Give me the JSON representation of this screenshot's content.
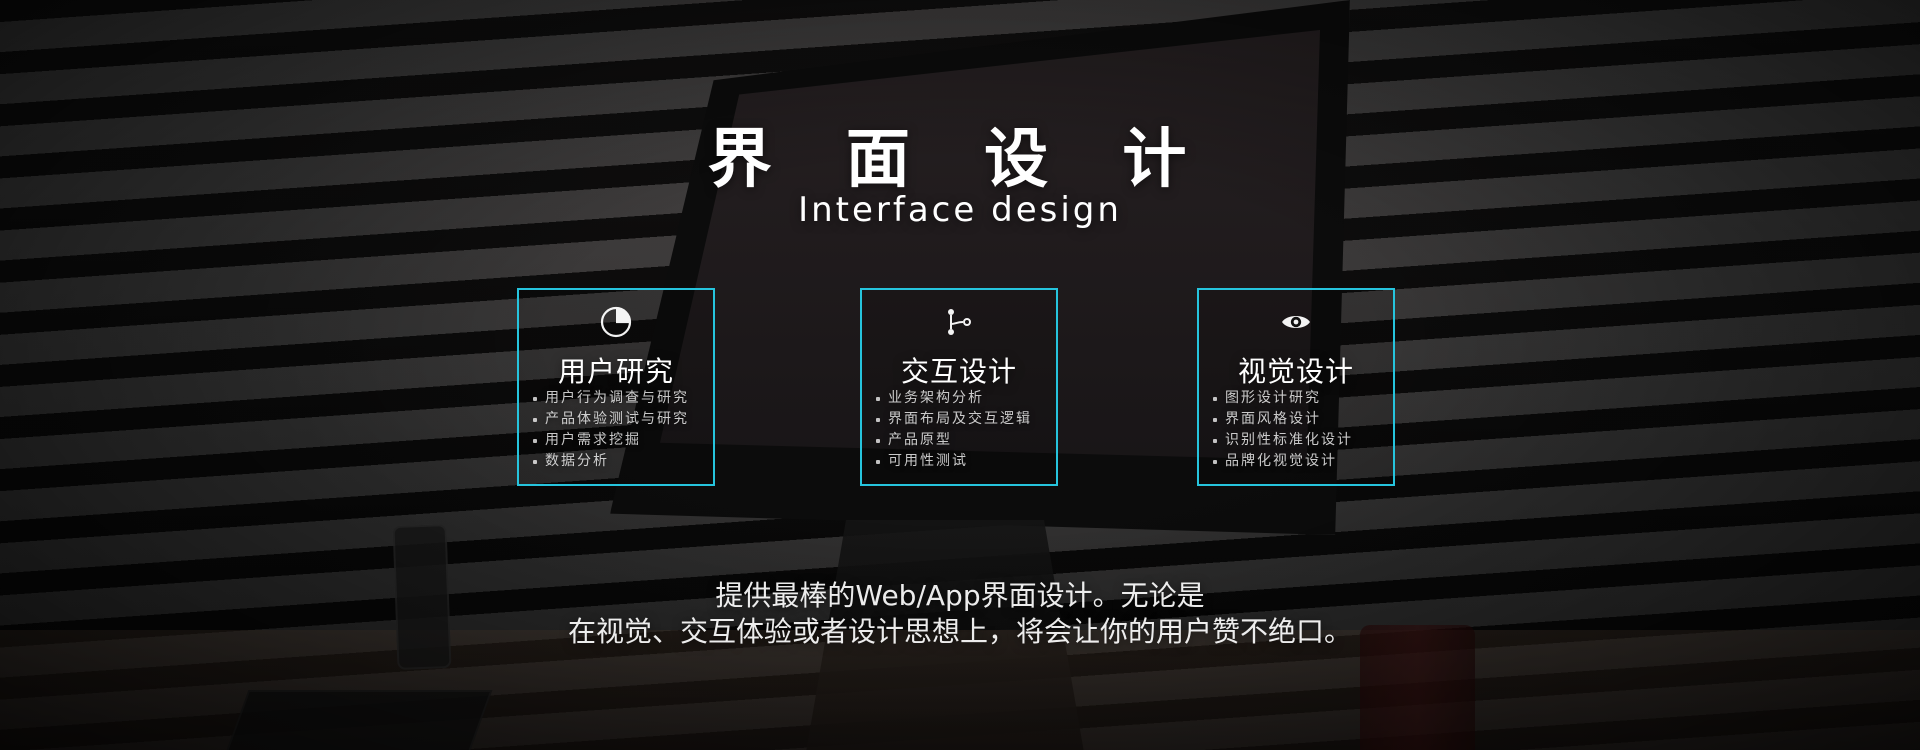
{
  "header": {
    "title": "界 面 设 计",
    "subtitle": "Interface design"
  },
  "cards": [
    {
      "icon": "pie-chart-icon",
      "title": "用户研究",
      "items": [
        "用户行为调查与研究",
        "产品体验测试与研究",
        "用户需求挖掘",
        "数据分析"
      ]
    },
    {
      "icon": "flow-icon",
      "title": "交互设计",
      "items": [
        "业务架构分析",
        "界面布局及交互逻辑",
        "产品原型",
        "可用性测试"
      ]
    },
    {
      "icon": "eye-icon",
      "title": "视觉设计",
      "items": [
        "图形设计研究",
        "界面风格设计",
        "识别性标准化设计",
        "品牌化视觉设计"
      ]
    }
  ],
  "footer": {
    "line1": "提供最棒的Web/App界面设计。无论是",
    "line2": "在视觉、交互体验或者设计思想上，将会让你的用户赞不绝口。"
  },
  "colors": {
    "accent_border": "#26c4dd"
  }
}
